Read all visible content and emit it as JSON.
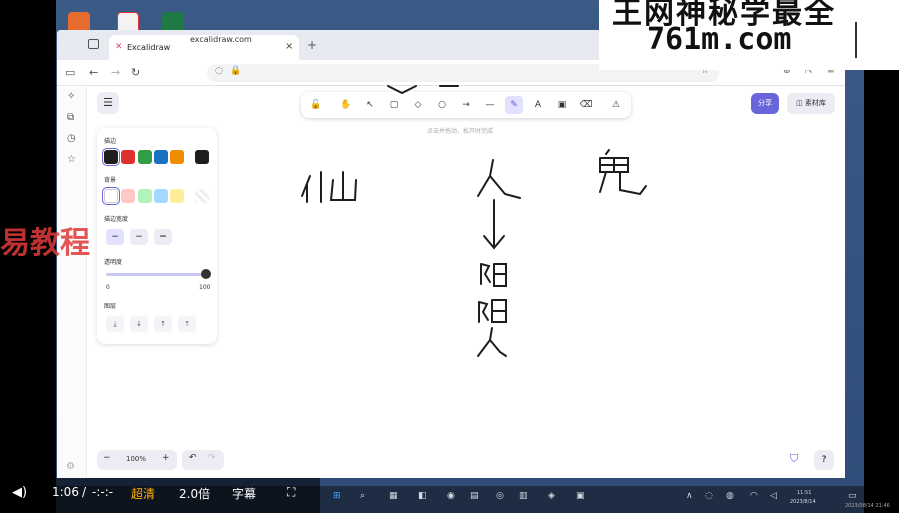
{
  "browser": {
    "tab_title": "Excalidraw",
    "tab_favicon": "✕",
    "tab_close": "×",
    "new_tab": "+",
    "url": "excalidraw.com"
  },
  "excalidraw": {
    "share_label": "分享",
    "library_label": "素材库",
    "canvas_hint": "点击并拖动，松开时完成",
    "panel": {
      "stroke_label": "描边",
      "background_label": "背景",
      "stroke_width_label": "描边宽度",
      "opacity_label": "透明度",
      "opacity_min": "0",
      "opacity_max": "100",
      "layers_label": "图层",
      "stroke_colors": [
        "#1e1e1e",
        "#e03131",
        "#2f9e44",
        "#1971c2",
        "#f08c00"
      ],
      "stroke_selected": "#1e1e1e",
      "background_colors": [
        "#ffffff",
        "#ffc9c9",
        "#b2f2bb",
        "#a5d8ff",
        "#ffec99"
      ],
      "opacity_value": 100
    },
    "zoom_level": "100%",
    "zoom_minus": "−",
    "zoom_plus": "+",
    "canvas_texts": {
      "left": "仙",
      "middle": "人",
      "right": "鬼",
      "arrow": "↓",
      "line2": "阴",
      "line3": "阳",
      "line4": "人"
    }
  },
  "video_player": {
    "current_time": "1:06",
    "separator": "/",
    "duration": "-:-:-",
    "quality": "超清",
    "speed": "2.0倍",
    "subtitles": "字幕"
  },
  "watermark": {
    "top_text": "王网神秘学最全",
    "url": "761m.com",
    "side_text": "易教程"
  },
  "taskbar": {
    "clock_time": "11:51",
    "clock_date": "2023/8/14"
  },
  "frame_stamp": "2023/08/14 21:46"
}
